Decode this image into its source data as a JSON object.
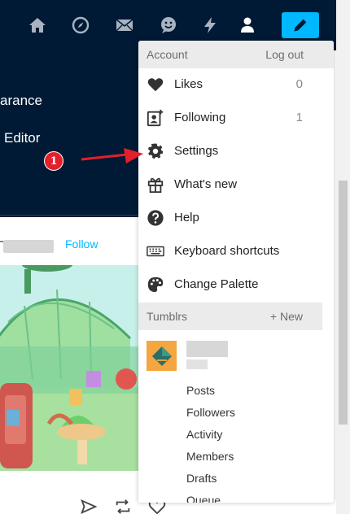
{
  "left_panel": {
    "appearance_partial": "arance",
    "editor_partial": "Editor"
  },
  "post": {
    "follow_label": "Follow"
  },
  "account_menu": {
    "header_label": "Account",
    "logout_label": "Log out",
    "items": [
      {
        "label": "Likes",
        "count": "0",
        "icon": "heart-icon"
      },
      {
        "label": "Following",
        "count": "1",
        "icon": "add-person-icon"
      },
      {
        "label": "Settings",
        "count": "",
        "icon": "gear-icon"
      },
      {
        "label": "What's new",
        "count": "",
        "icon": "gift-icon"
      },
      {
        "label": "Help",
        "count": "",
        "icon": "help-icon"
      },
      {
        "label": "Keyboard shortcuts",
        "count": "",
        "icon": "keyboard-icon"
      },
      {
        "label": "Change Palette",
        "count": "",
        "icon": "palette-icon"
      }
    ],
    "tumblrs_label": "Tumblrs",
    "new_label": "+ New",
    "blog_links": [
      "Posts",
      "Followers",
      "Activity",
      "Members",
      "Drafts",
      "Queue"
    ]
  },
  "annotation": {
    "step_number": "1"
  },
  "colors": {
    "navy": "#001935",
    "accent_blue": "#00b8ff",
    "annotation_red": "#e3202a"
  }
}
